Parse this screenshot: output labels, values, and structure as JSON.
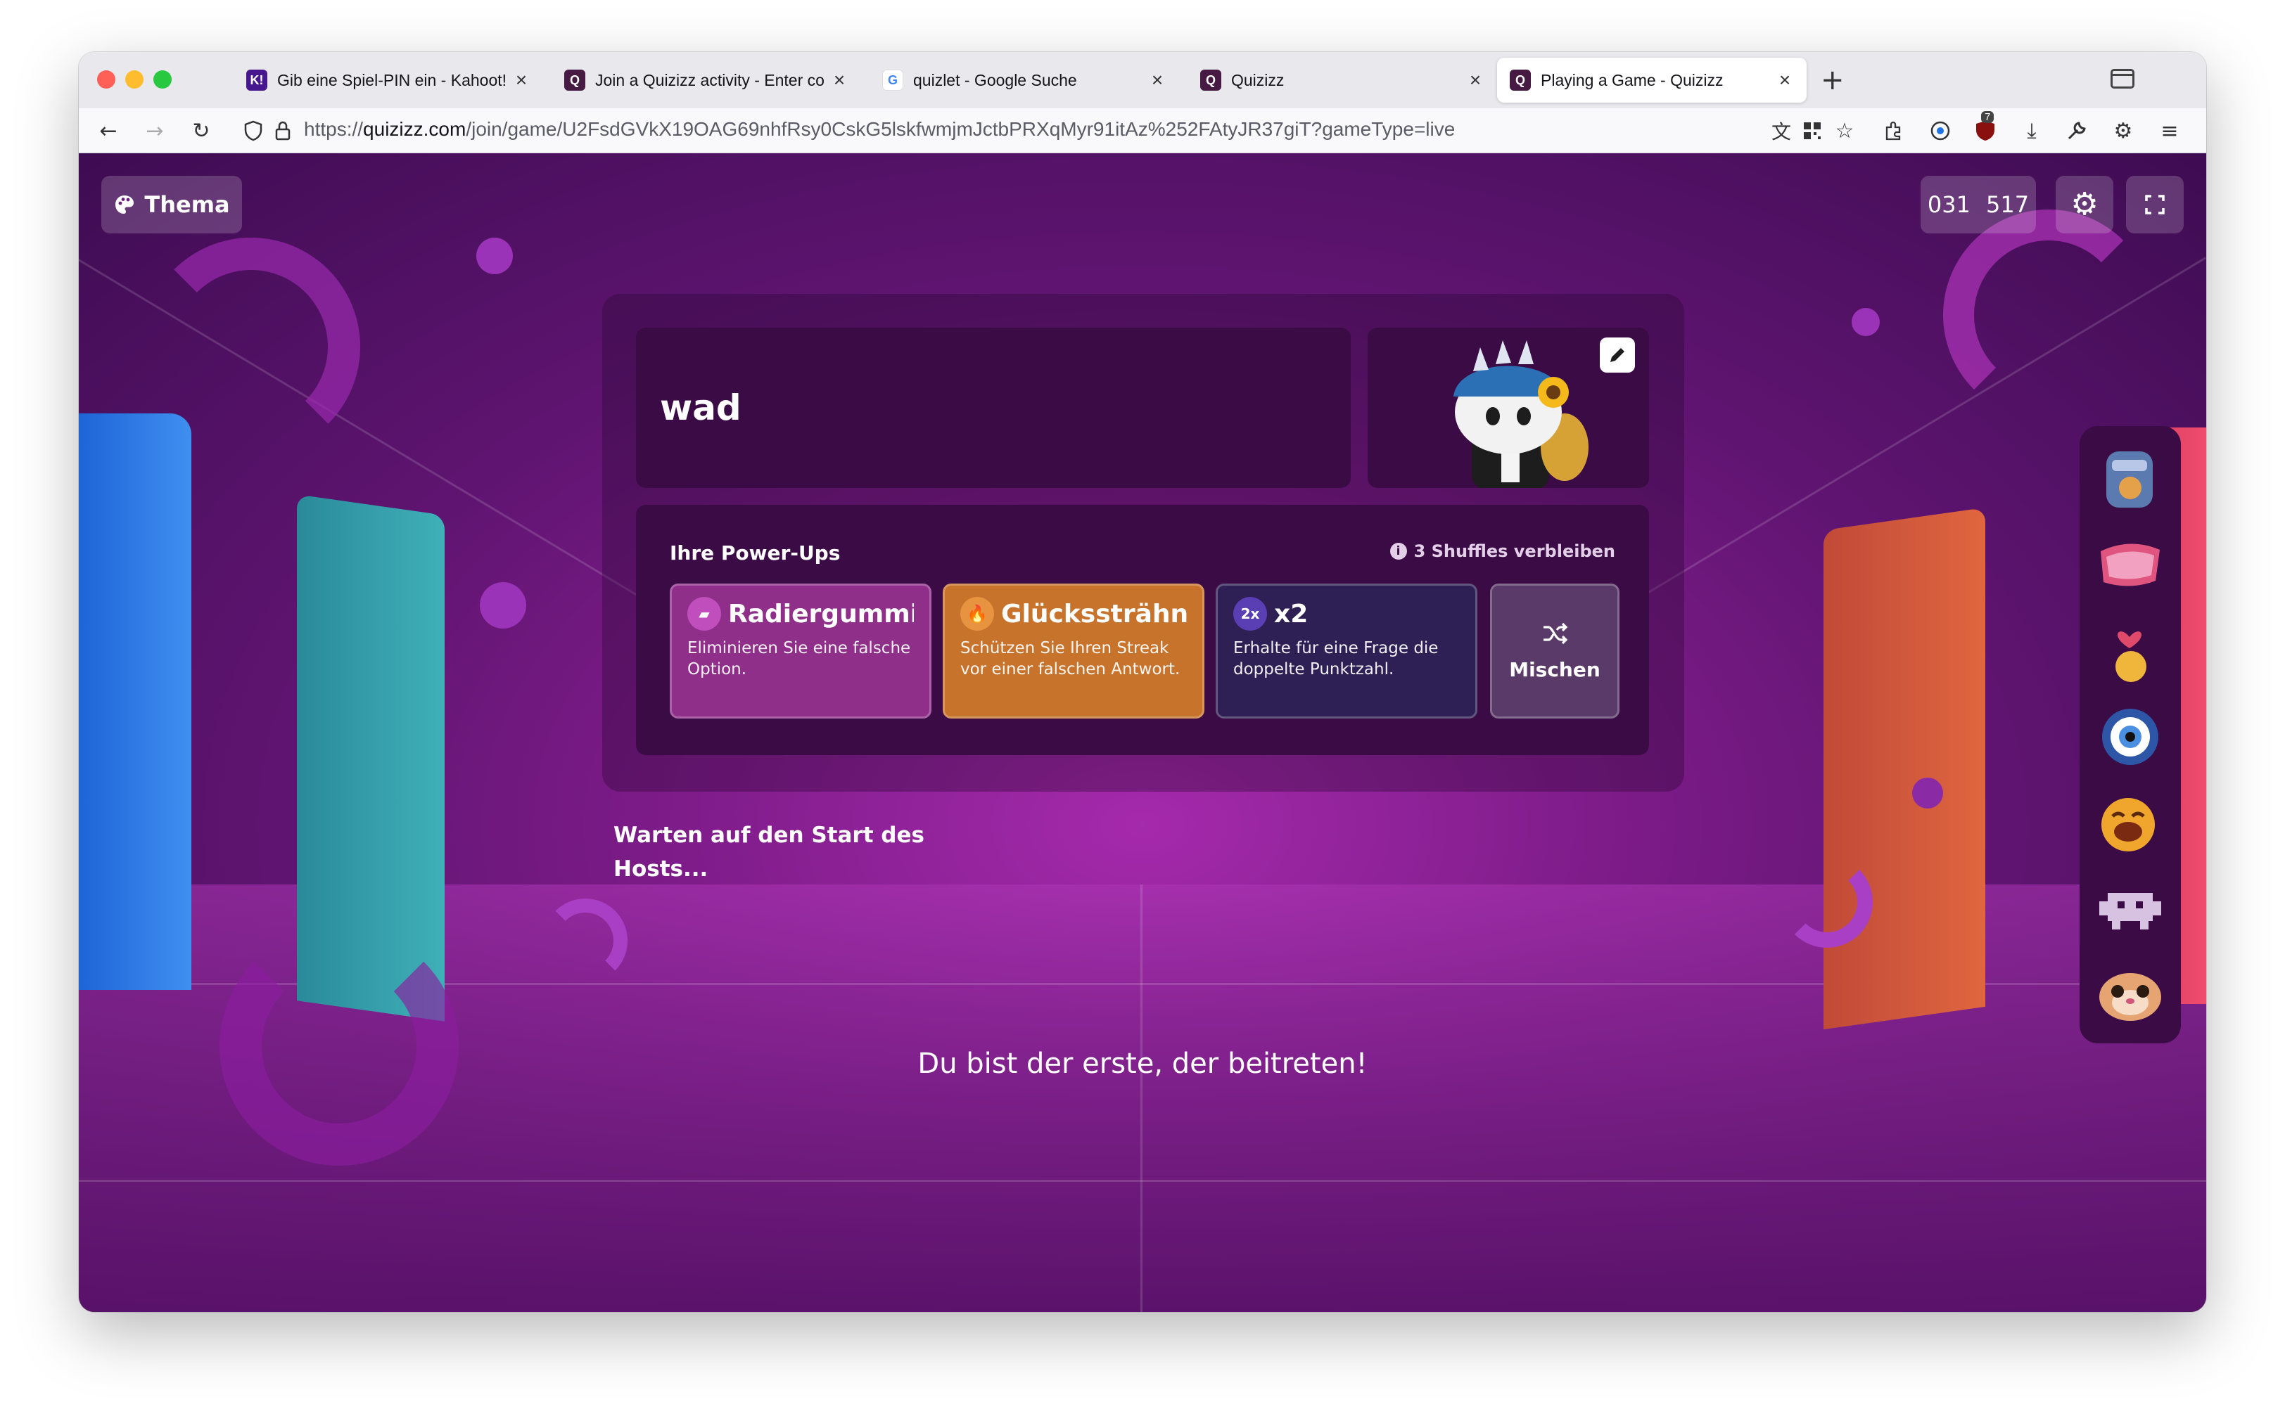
{
  "browser": {
    "tabs": [
      {
        "title": "Gib eine Spiel-PIN ein - Kahoot!",
        "favicon": "kahoot-icon",
        "favicon_text": "K!"
      },
      {
        "title": "Join a Quizizz activity - Enter co",
        "favicon": "quizizz-icon",
        "favicon_text": "Q"
      },
      {
        "title": "quizlet - Google Suche",
        "favicon": "google-icon",
        "favicon_text": "G"
      },
      {
        "title": "Quizizz",
        "favicon": "quizizz-icon",
        "favicon_text": "Q"
      },
      {
        "title": "Playing a Game - Quizizz",
        "favicon": "quizizz-icon",
        "favicon_text": "Q",
        "active": true
      }
    ],
    "url_prefix": "https://",
    "url_domain": "quizizz.com",
    "url_path": "/join/game/U2FsdGVkX19OAG69nhfRsy0CskG5lskfwmjmJctbPRXqMyr91itAz%252FAtyJR37giT?gameType=live",
    "extension_badge": "7"
  },
  "page": {
    "theme_button": "Thema",
    "code_part1": "031",
    "code_part2": "517",
    "player_name": "wad",
    "powerups_title": "Ihre Power-Ups",
    "shuffles_left": "3 Shuffles verbleiben",
    "powerups": [
      {
        "name": "Radiergummi",
        "description": "Eliminieren Sie eine falsche Option.",
        "color": "#8f2f8a",
        "icon": "eraser-icon",
        "icon_text": "▰"
      },
      {
        "name": "Glückssträhne...",
        "description": "Schützen Sie Ihren Streak vor einer falschen Antwort.",
        "color": "#c8732b",
        "icon": "flame-icon",
        "icon_text": "🔥"
      },
      {
        "name": "x2",
        "description": "Erhalte für eine Frage die doppelte Punktzahl.",
        "color": "#2e1f55",
        "icon": "double-points-icon",
        "icon_text": "2x"
      }
    ],
    "shuffle_label": "Mischen",
    "waiting_text": "Warten auf den Start des Hosts...",
    "first_joined_text": "Du bist der erste, der beitreten!"
  },
  "stickers": [
    "lets-go-sticker",
    "sup-sticker",
    "heart-hand-sticker",
    "eye-sticker",
    "laughing-sticker",
    "space-invader-sticker",
    "cat-sticker"
  ],
  "colors": {
    "page_bg": "#7f1c8a",
    "card_bg": "#3b0b46",
    "accent_orange": "#c8732b",
    "accent_pink": "#8f2f8a"
  }
}
